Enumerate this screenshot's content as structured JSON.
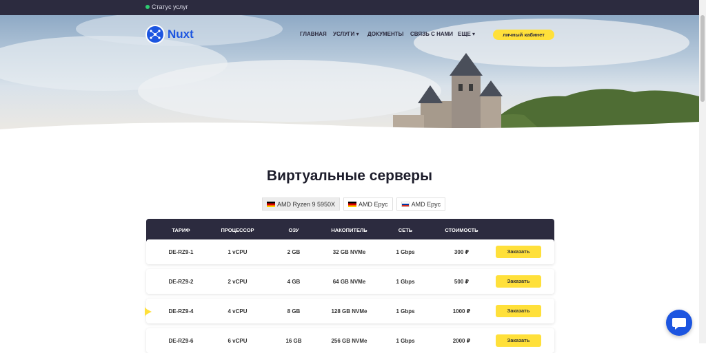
{
  "status": {
    "label": "Статус услуг",
    "dot_color": "#2ecc71"
  },
  "logo": {
    "text": "Nuxt",
    "color": "#1c55e0"
  },
  "nav": {
    "items": [
      {
        "label": "ГЛАВНАЯ",
        "has_dropdown": false
      },
      {
        "label": "УСЛУГИ",
        "has_dropdown": true
      },
      {
        "label": "ДОКУМЕНТЫ",
        "has_dropdown": false
      },
      {
        "label": "СВЯЗЬ С НАМИ",
        "has_dropdown": false
      },
      {
        "label": "ЕЩЕ",
        "has_dropdown": true
      }
    ],
    "cabinet_label": "личный кабинет",
    "cabinet_color": "#ffe03a"
  },
  "page_title": "Виртуальные серверы",
  "tabs": [
    {
      "label": "AMD Ryzen 9 5950X",
      "flag": "de",
      "active": true
    },
    {
      "label": "AMD Epyc",
      "flag": "de",
      "active": false
    },
    {
      "label": "AMD Epyc",
      "flag": "ru",
      "active": false
    }
  ],
  "table": {
    "headers": [
      "ТАРИФ",
      "ПРОЦЕССОР",
      "ОЗУ",
      "НАКОПИТЕЛЬ",
      "СЕТЬ",
      "СТОИМОСТЬ"
    ],
    "order_label": "Заказать",
    "rows": [
      {
        "plan": "DE-RZ9-1",
        "cpu": "1 vCPU",
        "ram": "2 GB",
        "disk": "32 GB NVMe",
        "net": "1 Gbps",
        "price": "300 ₽"
      },
      {
        "plan": "DE-RZ9-2",
        "cpu": "2 vCPU",
        "ram": "4 GB",
        "disk": "64 GB NVMe",
        "net": "1 Gbps",
        "price": "500 ₽"
      },
      {
        "plan": "DE-RZ9-4",
        "cpu": "4 vCPU",
        "ram": "8 GB",
        "disk": "128 GB NVMe",
        "net": "1 Gbps",
        "price": "1000 ₽"
      },
      {
        "plan": "DE-RZ9-6",
        "cpu": "6 vCPU",
        "ram": "16 GB",
        "disk": "256 GB NVMe",
        "net": "1 Gbps",
        "price": "2000 ₽"
      }
    ]
  },
  "colors": {
    "dark": "#2c2b3f",
    "accent": "#ffe03a",
    "brand": "#1c55e0"
  },
  "icons": {
    "chat": "chat-bubble-icon",
    "logo": "network-logo-icon",
    "star": "star-icon"
  }
}
